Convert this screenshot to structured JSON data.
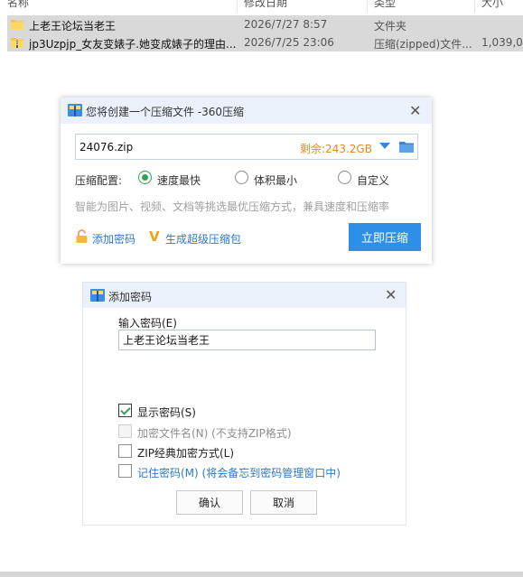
{
  "explorer": {
    "columns": [
      "名称",
      "修改日期",
      "类型",
      "大小"
    ],
    "files": [
      {
        "name": "上老王论坛当老王",
        "date": "2026/7/27 8:57",
        "type": "文件夹",
        "size": ""
      },
      {
        "name": "jp3Uzpjp_女友变婊子.她变成婊子的理由...",
        "date": "2026/7/25 23:06",
        "type": "压缩(zipped)文件...",
        "size": "1,039,0"
      }
    ]
  },
  "zip_dialog": {
    "title": "您将创建一个压缩文件 -360压缩",
    "path_value": "24076.zip",
    "free_space": "剩余:243.2GB",
    "config_label": "压缩配置:",
    "options": [
      {
        "label": "速度最快",
        "selected": true
      },
      {
        "label": "体积最小",
        "selected": false
      },
      {
        "label": "自定义",
        "selected": false
      }
    ],
    "hint": "智能为图片、视频、文档等挑选最优压缩方式，兼具速度和压缩率",
    "add_password": "添加密码",
    "super_package": "生成超级压缩包",
    "compress_button": "立即压缩"
  },
  "password_dialog": {
    "title": "添加密码",
    "input_label": "输入密码(E)",
    "password_value": "上老王论坛当老王",
    "checkboxes": [
      {
        "label": "显示密码(S)",
        "checked": true,
        "enabled": true
      },
      {
        "label": "加密文件名(N) (不支持ZIP格式)",
        "checked": false,
        "enabled": false
      },
      {
        "label": "ZIP经典加密方式(L)",
        "checked": false,
        "enabled": true
      },
      {
        "label": "记住密码(M) (将会备忘到密码管理窗口中)",
        "checked": false,
        "enabled": true
      }
    ],
    "ok_button": "确认",
    "cancel_button": "取消"
  },
  "colors": {
    "accent_blue": "#2d8fe8",
    "radio_green": "#2fa35a",
    "free_space_orange": "#e58a1f",
    "link_blue": "#2d78c9",
    "title_bar": "#eaf1fb"
  }
}
